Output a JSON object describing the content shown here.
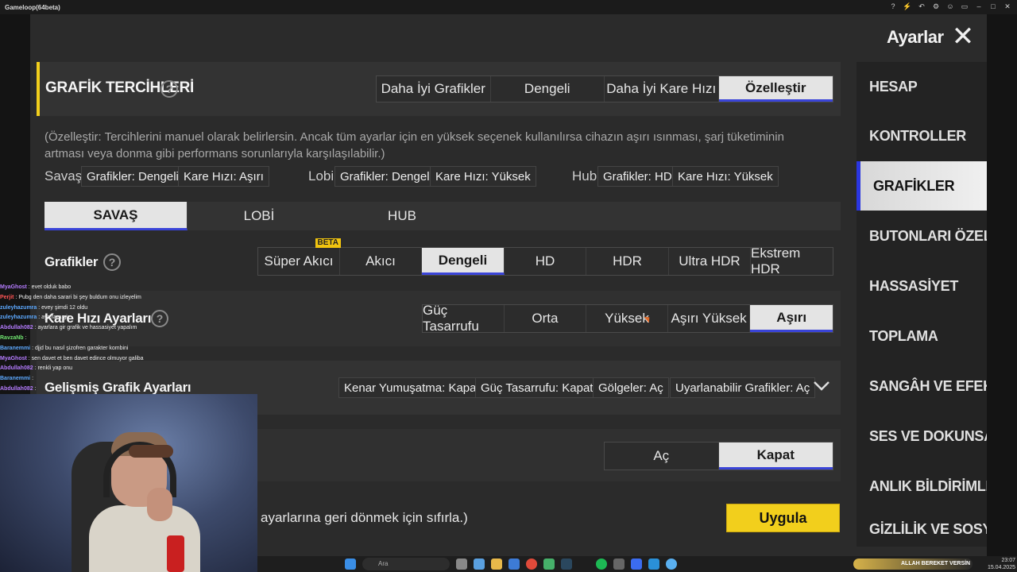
{
  "window": {
    "title": "Gameloop(64beta)"
  },
  "header": {
    "title": "Ayarlar",
    "close": "✕"
  },
  "preference": {
    "title": "GRAFİK TERCİHLERİ",
    "help": "?",
    "options": [
      "Daha İyi Grafikler",
      "Dengeli",
      "Daha İyi Kare Hızı",
      "Özelleştir"
    ],
    "selected": "Özelleştir",
    "description": "(Özelleştir: Tercihlerini manuel olarak belirlersin. Ancak tüm ayarlar için en yüksek seçenek kullanılırsa cihazın aşırı ısınması, şarj tüketiminin artması veya donma gibi performans sorunlarıyla karşılaşılabilir.)",
    "summary": {
      "battle_label": "Savaş",
      "battle_graphics": "Grafikler: Dengeli",
      "battle_fps": "Kare Hızı: Aşırı",
      "lobby_label": "Lobi",
      "lobby_graphics": "Grafikler: Dengeli",
      "lobby_fps": "Kare Hızı: Yüksek",
      "hub_label": "Hub",
      "hub_graphics": "Grafikler: HD",
      "hub_fps": "Kare Hızı: Yüksek"
    }
  },
  "mode_tabs": {
    "items": [
      "SAVAŞ",
      "LOBİ",
      "HUB"
    ],
    "selected": "SAVAŞ"
  },
  "graphics": {
    "title": "Grafikler",
    "help": "?",
    "options": [
      "Süper Akıcı",
      "Akıcı",
      "Dengeli",
      "HD",
      "HDR",
      "Ultra HDR",
      "Ekstrem HDR"
    ],
    "selected": "Dengeli",
    "beta_badge": "BETA"
  },
  "fps": {
    "title": "Kare Hızı Ayarları",
    "help": "?",
    "options": [
      "Güç Tasarrufu",
      "Orta",
      "Yüksek",
      "Aşırı Yüksek",
      "Aşırı"
    ],
    "selected": "Aşırı"
  },
  "advanced": {
    "title": "Gelişmiş Grafik Ayarları",
    "tags": [
      "Kenar Yumuşatma: Kapat",
      "Güç Tasarrufu: Kapat",
      "Gölgeler: Aç",
      "Uyarlanabilir Grafikler: Aç"
    ],
    "expand_icon": "chevron-down"
  },
  "toggle_row": {
    "options": [
      "Aç",
      "Kapat"
    ],
    "selected": "Kapat"
  },
  "footer": {
    "reset_text": "ayarlarına geri dönmek için sıfırla.)",
    "apply_label": "Uygula"
  },
  "sidebar": {
    "items": [
      "HESAP",
      "KONTROLLER",
      "GRAFİKLER",
      "BUTONLARI ÖZELLEŞ",
      "HASSASİYET",
      "TOPLAMA",
      "SANGÂH VE EFEKTLER",
      "SES VE DOKUNSAL",
      "ANLIK BİLDİRİMLER",
      "GİZLİLİK VE SOSYAL"
    ],
    "active": "GRAFİKLER"
  },
  "chat": {
    "messages": [
      {
        "user": "MyaGhost",
        "text": ": evet olduk babo",
        "color": "#b57cff"
      },
      {
        "user": "Perjit",
        "text": ": Pubg den daha sarari bi şey buldum onu izleyelim",
        "color": "#ff5555"
      },
      {
        "user": "zuleyhazumra",
        "text": ": evey şimdi 12 oldu",
        "color": "#5da9ff"
      },
      {
        "user": "zuleyhazumra",
        "text": ": ayarlara gir",
        "color": "#5da9ff"
      },
      {
        "user": "Abdullah082",
        "text": ": ayarlara gir grafik ve hassasiyet yapalım",
        "color": "#b57cff"
      },
      {
        "user": "RavzaNb",
        "text": ":",
        "color": "#6fe36f"
      },
      {
        "user": "Baranemmi",
        "text": ": djjd bu nasıl şizofren garakter kombini",
        "color": "#5da9ff"
      },
      {
        "user": "MyaGhost",
        "text": ": sen davet et ben davet edince olmuyor galiba",
        "color": "#b57cff"
      },
      {
        "user": "Abdullah082",
        "text": ": renkli yap onu",
        "color": "#b57cff"
      },
      {
        "user": "Baranemmi",
        "text": ":",
        "color": "#5da9ff"
      },
      {
        "user": "Abdullah082",
        "text": ":",
        "color": "#b57cff"
      }
    ]
  },
  "taskbar": {
    "search_placeholder": "Ara",
    "news_text": "ALLAH BEREKET VERSİN",
    "clock": "23:07",
    "date": "15.04.2025"
  },
  "colors": {
    "accent_blue": "#3a44d8",
    "apply_yellow": "#f2cf1c",
    "pref_bar": "#f2cf1c"
  }
}
